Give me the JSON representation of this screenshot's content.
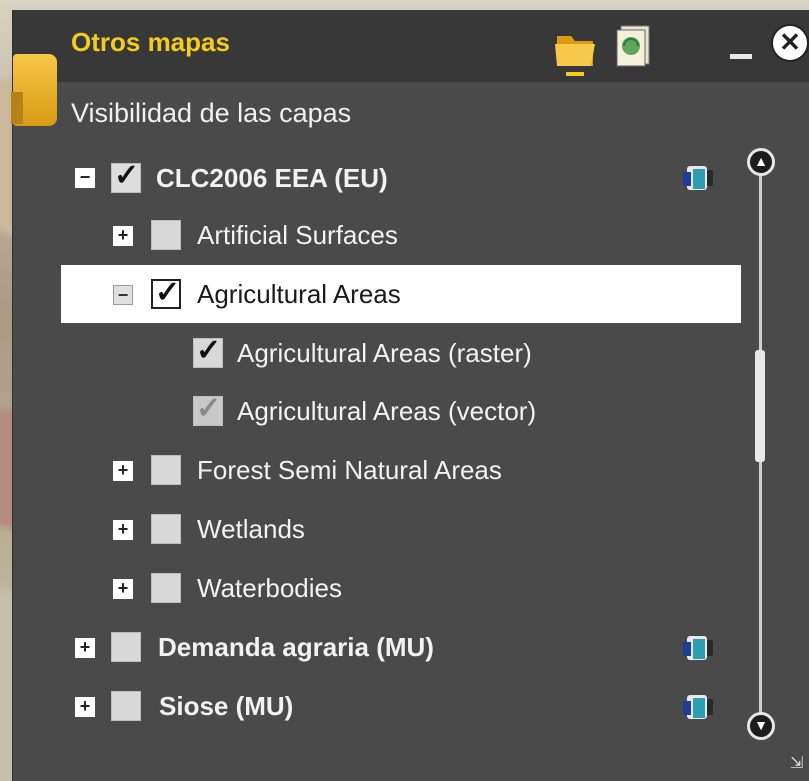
{
  "panel": {
    "title": "Otros mapas",
    "subtitle": "Visibilidad de las capas",
    "accent_color": "#f4cc1f"
  },
  "header_icons": {
    "folder": "folder-icon",
    "document": "map-document-icon",
    "minimize": "minimize-icon",
    "close": "close-icon",
    "close_glyph": "✕"
  },
  "layers": [
    {
      "label": "CLC2006 EEA (EU)",
      "toggle": "−",
      "checked": true,
      "bold": true,
      "has_info_icon": true
    },
    {
      "label": "Artificial Surfaces",
      "toggle": "+",
      "checked": false
    },
    {
      "label": "Agricultural Areas",
      "toggle": "−",
      "checked": true,
      "selected": true
    },
    {
      "label": "Agricultural Areas (raster)",
      "checked": true
    },
    {
      "label": "Agricultural Areas (vector)",
      "checked": true,
      "disabled": true
    },
    {
      "label": "Forest Semi Natural Areas",
      "toggle": "+",
      "checked": false
    },
    {
      "label": "Wetlands",
      "toggle": "+",
      "checked": false
    },
    {
      "label": "Waterbodies",
      "toggle": "+",
      "checked": false
    },
    {
      "label": "Demanda agraria (MU)",
      "toggle": "+",
      "checked": false,
      "bold": true,
      "has_info_icon": true
    },
    {
      "label": "Siose (MU)",
      "toggle": "+",
      "checked": false,
      "bold": true,
      "has_info_icon": true
    }
  ],
  "scrollbar": {
    "up_icon": "scroll-up-icon",
    "down_icon": "scroll-down-icon"
  },
  "resize_icon": "resize-handle-icon"
}
